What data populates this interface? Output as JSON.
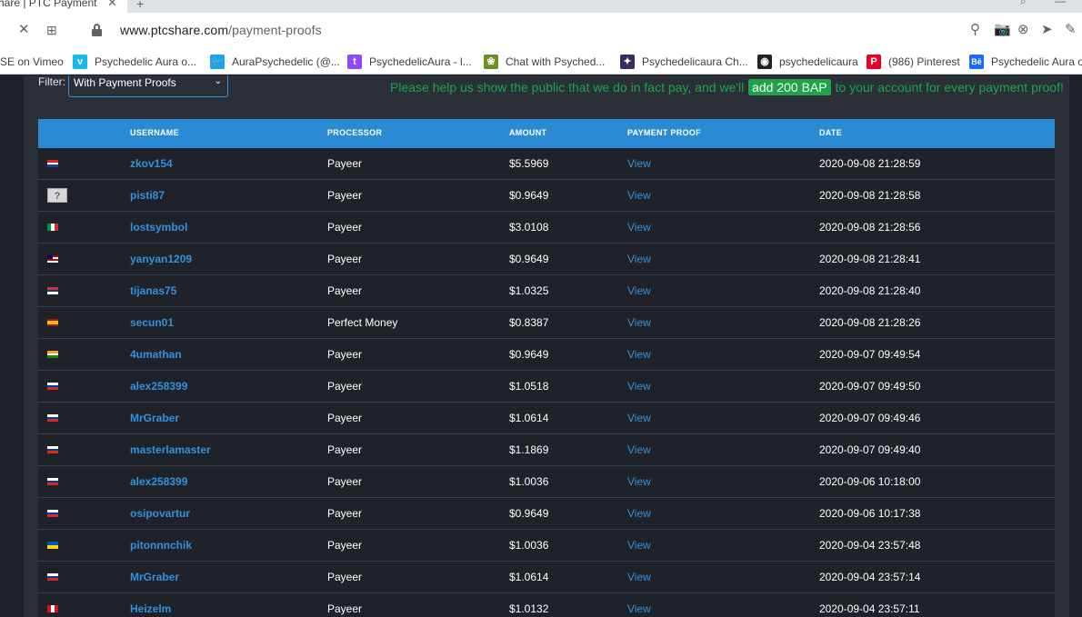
{
  "browser": {
    "tab_title": "hare | PTC Payment Pr",
    "tab_close": "✕",
    "new_tab": "+",
    "url_host": "www.ptcshare.com",
    "url_path": "/payment-proofs",
    "bookmarks": [
      {
        "label": "SE on Vimeo",
        "fav": "",
        "color": ""
      },
      {
        "label": "Psychedelic Aura o...",
        "fav": "v",
        "color": "#1ab7ea"
      },
      {
        "label": "AuraPsychedelic (@...",
        "fav": "🐦",
        "color": "#1da1f2"
      },
      {
        "label": "PsychedelicAura - l...",
        "fav": "t",
        "color": "#9146ff"
      },
      {
        "label": "Chat with Psyched...",
        "fav": "❀",
        "color": "#6b8e23"
      },
      {
        "label": "Psychedelicaura Ch...",
        "fav": "✦",
        "color": "#3b2a5c"
      },
      {
        "label": "psychedelicaura",
        "fav": "◉",
        "color": "#222222"
      },
      {
        "label": "(986) Pinterest",
        "fav": "P",
        "color": "#e60023"
      },
      {
        "label": "Psychedelic Aura o",
        "fav": "Bē",
        "color": "#1769ff"
      }
    ]
  },
  "filter": {
    "label": "Filter:",
    "selected": "With Payment Proofs"
  },
  "promo": {
    "before": "Please help us show the public that we do in fact pay, and we'll",
    "badge": "add 200 BAP",
    "after": "to your account for every payment proof!"
  },
  "table": {
    "headers": [
      "USERNAME",
      "PROCESSOR",
      "AMOUNT",
      "PAYMENT PROOF",
      "DATE"
    ],
    "rows": [
      {
        "flag": "hr",
        "username": "zkov154",
        "processor": "Payeer",
        "amount": "$5.5969",
        "proof": "View",
        "date": "2020-09-08 21:28:59"
      },
      {
        "flag": "unknown",
        "username": "pisti87",
        "processor": "Payeer",
        "amount": "$0.9649",
        "proof": "View",
        "date": "2020-09-08 21:28:58"
      },
      {
        "flag": "it",
        "username": "lostsymbol",
        "processor": "Payeer",
        "amount": "$3.0108",
        "proof": "View",
        "date": "2020-09-08 21:28:56"
      },
      {
        "flag": "my",
        "username": "yanyan1209",
        "processor": "Payeer",
        "amount": "$0.9649",
        "proof": "View",
        "date": "2020-09-08 21:28:41"
      },
      {
        "flag": "rs",
        "username": "tijanas75",
        "processor": "Payeer",
        "amount": "$1.0325",
        "proof": "View",
        "date": "2020-09-08 21:28:40"
      },
      {
        "flag": "es",
        "username": "secun01",
        "processor": "Perfect Money",
        "amount": "$0.8387",
        "proof": "View",
        "date": "2020-09-08 21:28:26"
      },
      {
        "flag": "in",
        "username": "4umathan",
        "processor": "Payeer",
        "amount": "$0.9649",
        "proof": "View",
        "date": "2020-09-07 09:49:54"
      },
      {
        "flag": "ru",
        "username": "alex258399",
        "processor": "Payeer",
        "amount": "$1.0518",
        "proof": "View",
        "date": "2020-09-07 09:49:50"
      },
      {
        "flag": "ru",
        "username": "MrGraber",
        "processor": "Payeer",
        "amount": "$1.0614",
        "proof": "View",
        "date": "2020-09-07 09:49:46"
      },
      {
        "flag": "ru",
        "username": "masterlamaster",
        "processor": "Payeer",
        "amount": "$1.1869",
        "proof": "View",
        "date": "2020-09-07 09:49:40"
      },
      {
        "flag": "ru",
        "username": "alex258399",
        "processor": "Payeer",
        "amount": "$1.0036",
        "proof": "View",
        "date": "2020-09-06 10:18:00"
      },
      {
        "flag": "ru",
        "username": "osipovartur",
        "processor": "Payeer",
        "amount": "$0.9649",
        "proof": "View",
        "date": "2020-09-06 10:17:38"
      },
      {
        "flag": "ua",
        "username": "pitonnnchik",
        "processor": "Payeer",
        "amount": "$1.0036",
        "proof": "View",
        "date": "2020-09-04 23:57:48"
      },
      {
        "flag": "ru",
        "username": "MrGraber",
        "processor": "Payeer",
        "amount": "$1.0614",
        "proof": "View",
        "date": "2020-09-04 23:57:14"
      },
      {
        "flag": "pe",
        "username": "Heizelm",
        "processor": "Payeer",
        "amount": "$1.0132",
        "proof": "View",
        "date": "2020-09-04 23:57:11"
      }
    ]
  },
  "colors": {
    "header_blue": "#2a8ad4",
    "link_blue": "#3491db",
    "promo_green": "#1fa34a",
    "row_bg": "#1f2229"
  }
}
